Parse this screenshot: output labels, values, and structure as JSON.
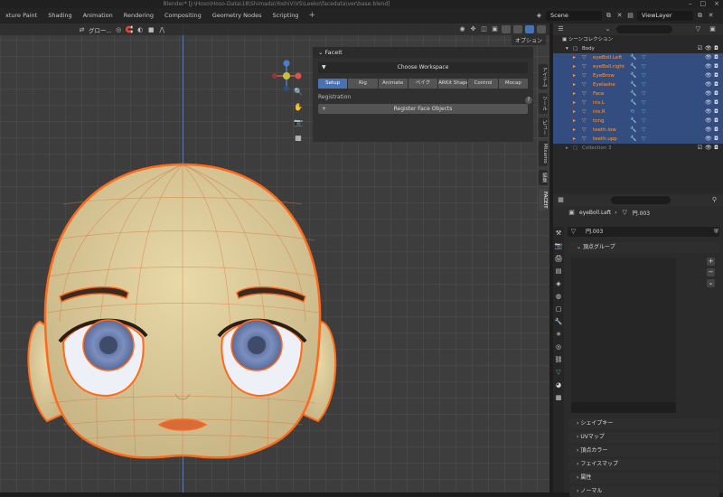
{
  "window": {
    "title": "Blender* [J:\\Hoso\\Hoso-Data\\18\\Shimada\\YoshiV\\VS\\Leeko\\facedata\\ver\\base.blend]",
    "controls": [
      "–",
      "□",
      "×"
    ]
  },
  "workspace_tabs": [
    "xture Paint",
    "Shading",
    "Animation",
    "Rendering",
    "Compositing",
    "Geometry Nodes",
    "Scripting"
  ],
  "scene": {
    "name": "Scene",
    "view_layer": "ViewLayer"
  },
  "viewport": {
    "transform_label": "グロー...",
    "options_label": "オプション",
    "accent": "#4772b3"
  },
  "faceit": {
    "title": "FaceIt",
    "choose_workspace": "Choose Workspace",
    "tabs": [
      "Setup",
      "Rig",
      "Animate",
      "ベイク",
      "ARKit Shapes",
      "Control",
      "Mocap"
    ],
    "active_tab": "Setup",
    "registration_label": "Registration",
    "register_button": "Register Face Objects",
    "help": "?"
  },
  "sidebar_tabs": [
    "アイテム",
    "ツール",
    "ビュー",
    "Mixamo",
    "編集",
    "FACEIT"
  ],
  "outliner": {
    "header": "シーンコレクション",
    "items": [
      {
        "label": "Body",
        "selected": false
      },
      {
        "label": "eyeBoll.Left",
        "selected": true
      },
      {
        "label": "eyeBoll.right",
        "selected": true
      },
      {
        "label": "EyeBrow",
        "selected": true
      },
      {
        "label": "Eyelashe",
        "selected": true
      },
      {
        "label": "Face",
        "selected": true
      },
      {
        "label": "iris.L",
        "selected": true
      },
      {
        "label": "iris.R",
        "selected": true
      },
      {
        "label": "tong",
        "selected": true
      },
      {
        "label": "teeth.low",
        "selected": true
      },
      {
        "label": "teeth.upp",
        "selected": true
      },
      {
        "label": "Collection 3",
        "selected": false
      }
    ]
  },
  "properties": {
    "object": "eyeBoll.Left",
    "mesh": "円.003",
    "mesh_field": "円.003",
    "vertex_groups": "頂点グループ",
    "sections": [
      "シェイプキー",
      "UVマップ",
      "頂点カラー",
      "フェイスマップ",
      "属性",
      "ノーマル"
    ]
  }
}
